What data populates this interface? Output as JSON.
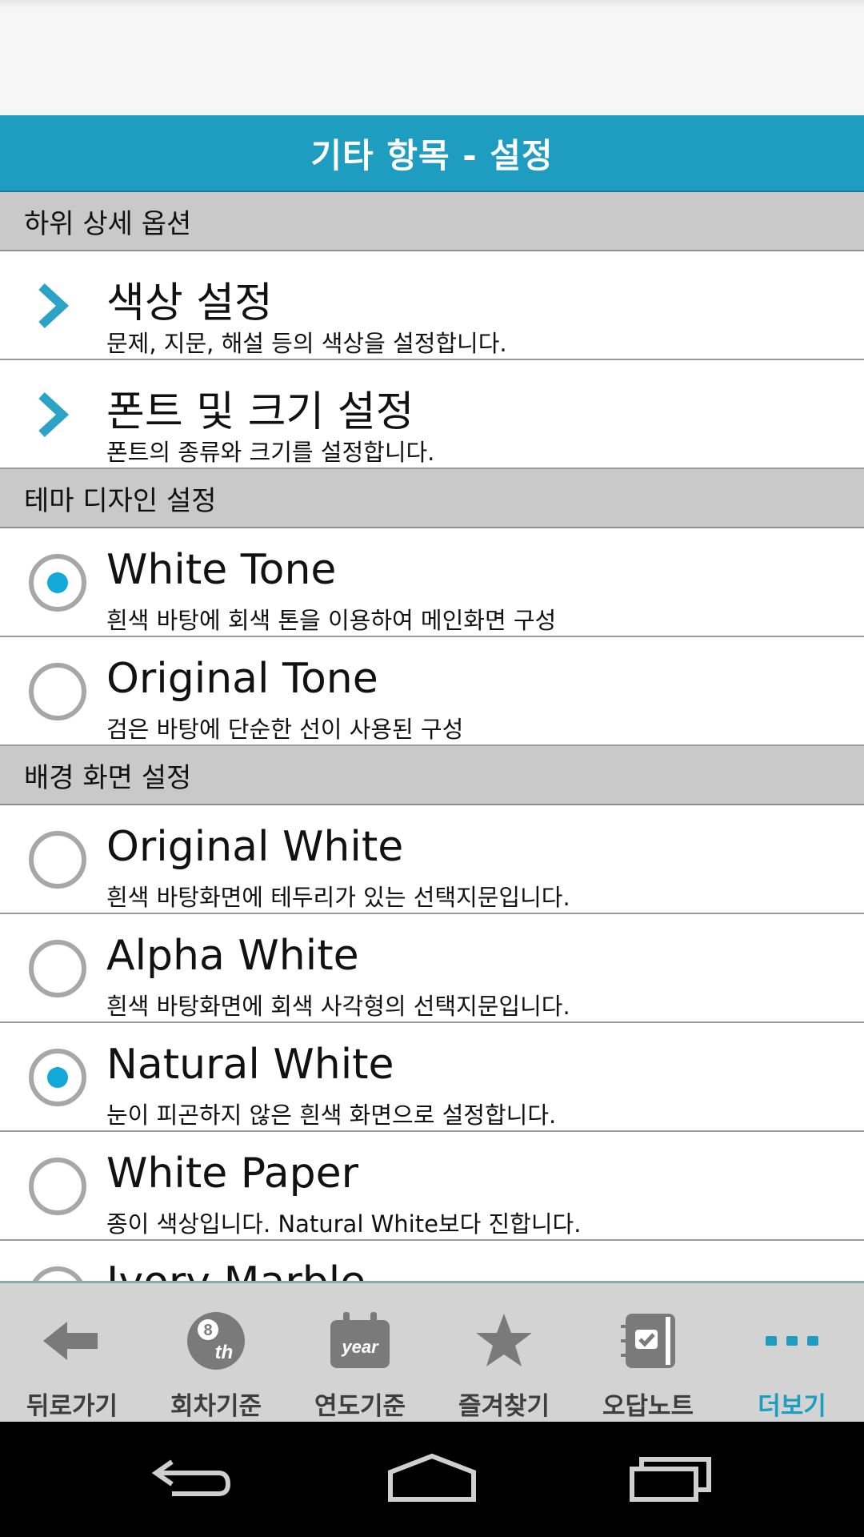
{
  "header": {
    "title": "기타 항목 - 설정"
  },
  "sections": {
    "detail": {
      "label": "하위 상세 옵션",
      "items": [
        {
          "title": "색상 설정",
          "desc": "문제, 지문, 해설 등의 색상을 설정합니다."
        },
        {
          "title": "폰트 및 크기 설정",
          "desc": "폰트의 종류와 크기를 설정합니다."
        }
      ]
    },
    "theme": {
      "label": "테마 디자인 설정",
      "items": [
        {
          "title": "White Tone",
          "desc": "흰색 바탕에 회색 톤을 이용하여 메인화면 구성",
          "selected": true
        },
        {
          "title": "Original Tone",
          "desc": "검은 바탕에 단순한 선이 사용된 구성",
          "selected": false
        }
      ]
    },
    "background": {
      "label": "배경 화면 설정",
      "items": [
        {
          "title": "Original White",
          "desc": "흰색 바탕화면에 테두리가 있는 선택지문입니다.",
          "selected": false
        },
        {
          "title": "Alpha White",
          "desc": "흰색 바탕화면에 회색 사각형의 선택지문입니다.",
          "selected": false
        },
        {
          "title": "Natural White",
          "desc": "눈이 피곤하지 않은 흰색 화면으로 설정합니다.",
          "selected": true
        },
        {
          "title": "White Paper",
          "desc": "종이 색상입니다. Natural White보다 진합니다.",
          "selected": false
        },
        {
          "title": "Ivory Marble",
          "desc": "",
          "selected": false
        }
      ]
    }
  },
  "bottom_nav": {
    "items": [
      {
        "label": "뒤로가기",
        "icon": "back-arrow-icon"
      },
      {
        "label": "회차기준",
        "icon": "eight-ball-th-icon"
      },
      {
        "label": "연도기준",
        "icon": "year-calendar-icon"
      },
      {
        "label": "즐겨찾기",
        "icon": "star-icon"
      },
      {
        "label": "오답노트",
        "icon": "notebook-check-icon"
      },
      {
        "label": "더보기",
        "icon": "more-dots-icon",
        "active": true
      }
    ]
  },
  "colors": {
    "accent": "#1f9dc0",
    "radio_dot": "#12a8d8",
    "section_bg": "#c9c9c9",
    "nav_bg": "#d3d3d3"
  },
  "system_nav": {
    "icons": [
      "back-icon",
      "home-icon",
      "recents-icon"
    ]
  }
}
